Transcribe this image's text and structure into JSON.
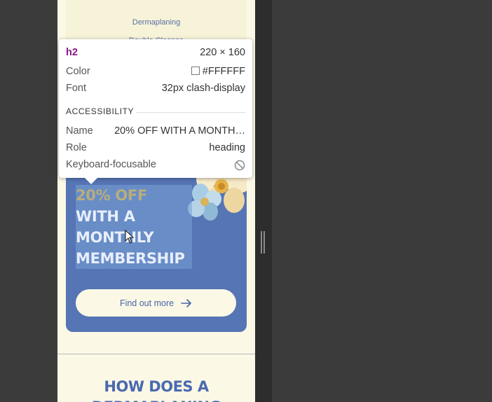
{
  "page": {
    "menu_links": [
      "Dermaplaning",
      "Double Cleanse"
    ],
    "promo": {
      "headline_line1": "20% OFF",
      "headline_rest": "WITH A MONTHLY MEMBERSHIP",
      "cta_label": "Find out more",
      "cta_icon": "arrow-right-icon"
    },
    "section_title_line1": "HOW DOES A",
    "section_title_line2": "DERMAPLANING"
  },
  "inspector": {
    "tag": "h2",
    "size": "220 × 160",
    "color_label": "Color",
    "color_value": "#FFFFFF",
    "font_label": "Font",
    "font_value": "32px clash-display",
    "accessibility_heading": "ACCESSIBILITY",
    "name_label": "Name",
    "name_value": "20% OFF WITH A MONTH…",
    "role_label": "Role",
    "role_value": "heading",
    "focusable_label": "Keyboard-focusable",
    "focusable_icon": "not-allowed-icon"
  },
  "colors": {
    "promo_bg": "#5575b4",
    "page_bg": "#fbf8e6",
    "accent": "#4a6ab0",
    "tag": "#8e1687"
  }
}
